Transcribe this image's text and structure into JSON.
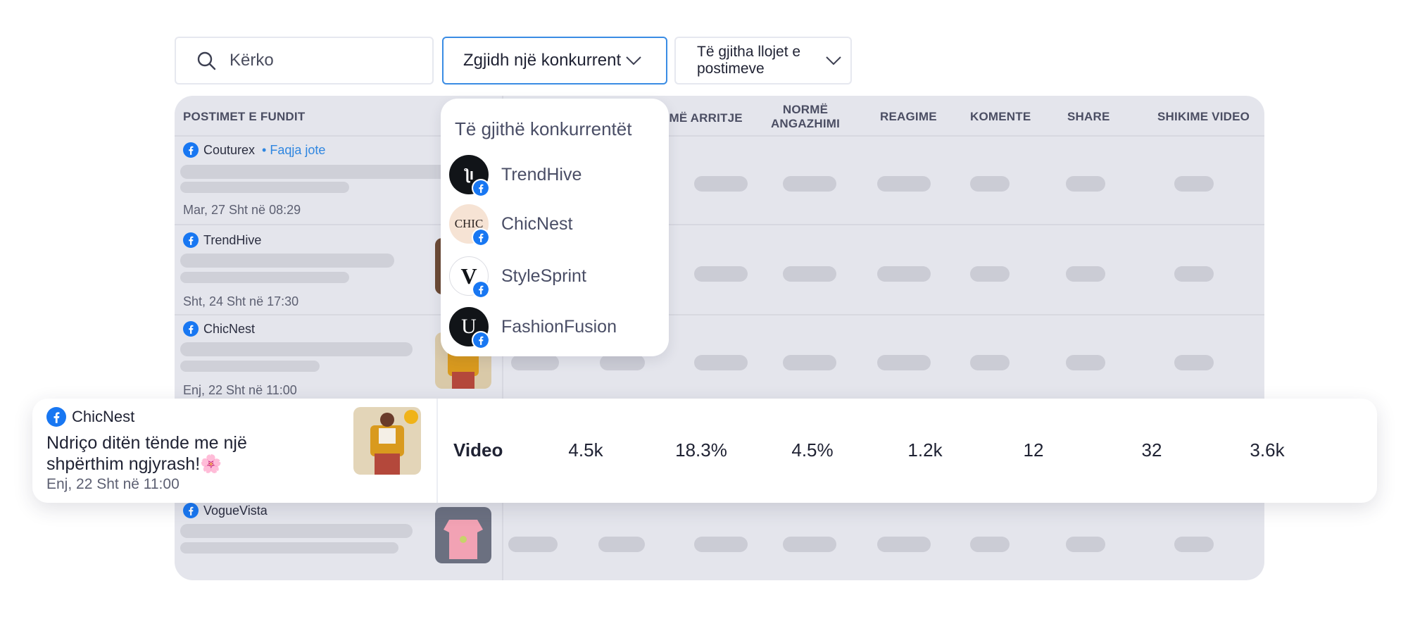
{
  "search": {
    "placeholder": "Kërko",
    "icon": "search-icon"
  },
  "competitor_select": {
    "label": "Zgjidh një konkurrent"
  },
  "post_type_select": {
    "label": "Të gjitha llojet e postimeve"
  },
  "table": {
    "headers": {
      "posts": "POSTIMET E FUNDIT",
      "reach_rate": "RMË ARRITJE",
      "engagement_rate": "NORMË ANGAZHIMI",
      "reactions": "REAGIME",
      "comments": "KOMENTE",
      "shares": "SHARE",
      "video_views": "SHIKIME VIDEO"
    },
    "rows": [
      {
        "account": "Couturex",
        "tag": "• Faqja jote",
        "date": "Mar, 27 Sht në 08:29"
      },
      {
        "account": "TrendHive",
        "tag": "",
        "date": "Sht, 24 Sht në 17:30"
      },
      {
        "account": "ChicNest",
        "tag": "",
        "date": "Enj, 22 Sht në 11:00"
      },
      {
        "account": "VogueVista",
        "tag": "",
        "date": ""
      }
    ]
  },
  "dropdown": {
    "title": "Të gjithë konkurrentët",
    "options": [
      {
        "name": "TrendHive",
        "logo_text": "ƪı"
      },
      {
        "name": "ChicNest",
        "logo_text": "CHIC"
      },
      {
        "name": "StyleSprint",
        "logo_text": "V"
      },
      {
        "name": "FashionFusion",
        "logo_text": "U"
      }
    ]
  },
  "highlight_row": {
    "account": "ChicNest",
    "caption": "Ndriço ditën tënde me një shpërthim ngjyrash!🌸",
    "date": "Enj, 22 Sht në 11:00",
    "type": "Video",
    "metrics": [
      "4.5k",
      "18.3%",
      "4.5%",
      "1.2k",
      "12",
      "32",
      "3.6k"
    ]
  },
  "colors": {
    "facebook_blue": "#1877f2",
    "accent_border": "#3a8ce4",
    "link_blue": "#2f86e0",
    "panel_bg": "#e4e5ec"
  }
}
